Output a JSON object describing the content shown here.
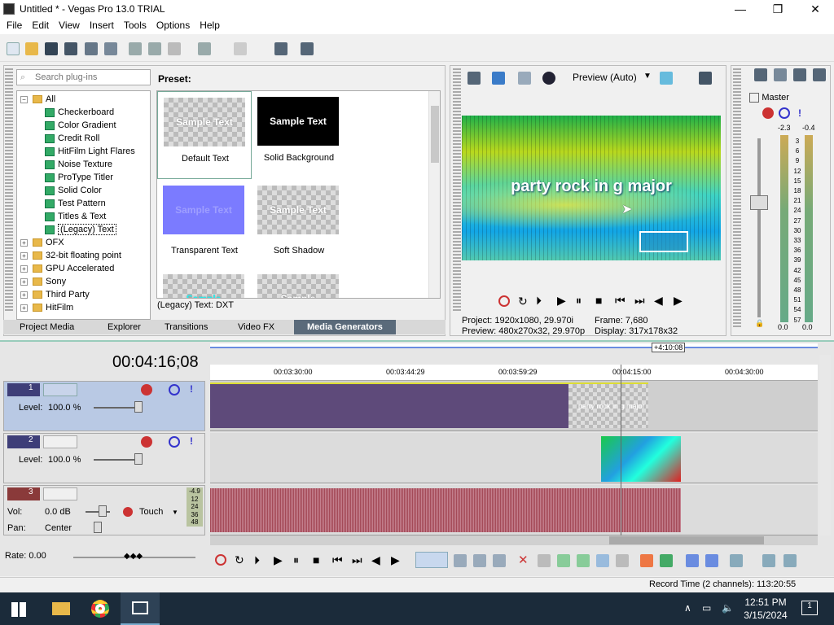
{
  "window": {
    "title": "Untitled * - Vegas Pro 13.0 TRIAL",
    "min": "—",
    "max": "❐",
    "close": "✕"
  },
  "menu": [
    "File",
    "Edit",
    "View",
    "Insert",
    "Tools",
    "Options",
    "Help"
  ],
  "explorer": {
    "search_placeholder": "Search plug-ins",
    "preset_label": "Preset:",
    "tree": [
      {
        "label": "All",
        "type": "folder",
        "level": 0,
        "exp": "−"
      },
      {
        "label": "Checkerboard",
        "type": "plugin",
        "level": 1
      },
      {
        "label": "Color Gradient",
        "type": "plugin",
        "level": 1
      },
      {
        "label": "Credit Roll",
        "type": "plugin",
        "level": 1
      },
      {
        "label": "HitFilm Light Flares",
        "type": "plugin",
        "level": 1
      },
      {
        "label": "Noise Texture",
        "type": "plugin",
        "level": 1
      },
      {
        "label": "ProType Titler",
        "type": "plugin",
        "level": 1
      },
      {
        "label": "Solid Color",
        "type": "plugin",
        "level": 1
      },
      {
        "label": "Test Pattern",
        "type": "plugin",
        "level": 1
      },
      {
        "label": "Titles & Text",
        "type": "plugin",
        "level": 1
      },
      {
        "label": "(Legacy) Text",
        "type": "plugin",
        "level": 1,
        "selected": true
      },
      {
        "label": "OFX",
        "type": "folder",
        "level": 0,
        "exp": "+"
      },
      {
        "label": "32-bit floating point",
        "type": "folder",
        "level": 0,
        "exp": "+"
      },
      {
        "label": "GPU Accelerated",
        "type": "folder",
        "level": 0,
        "exp": "+"
      },
      {
        "label": "Sony",
        "type": "folder",
        "level": 0,
        "exp": "+"
      },
      {
        "label": "Third Party",
        "type": "folder",
        "level": 0,
        "exp": "+"
      },
      {
        "label": "HitFilm",
        "type": "folder",
        "level": 0,
        "exp": "+"
      }
    ],
    "presets": [
      {
        "name": "Default Text",
        "thumb": "Sample Text",
        "style": "checker",
        "selected": true
      },
      {
        "name": "Solid Background",
        "thumb": "Sample Text",
        "style": "black"
      },
      {
        "name": "Transparent Text",
        "thumb": "Sample Text",
        "style": "blue"
      },
      {
        "name": "Soft Shadow",
        "thumb": "Sample Text",
        "style": "checker"
      },
      {
        "name": "",
        "thumb": "Sample",
        "style": "checker-cyan"
      },
      {
        "name": "",
        "thumb": "Sample",
        "style": "checker"
      }
    ],
    "status": "(Legacy) Text: DXT",
    "tabs": [
      "Project Media",
      "Explorer",
      "Transitions",
      "Video FX",
      "Media Generators"
    ],
    "active_tab": "Media Generators"
  },
  "preview": {
    "mode": "Preview (Auto)",
    "overlay_text": "party rock in g major",
    "project_label": "Project:",
    "project_value": "1920x1080, 29.970i",
    "frame_label": "Frame:",
    "frame_value": "7,680",
    "preview_label": "Preview:",
    "preview_value": "480x270x32, 29.970p",
    "display_label": "Display:",
    "display_value": "317x178x32"
  },
  "mixer": {
    "title": "Master",
    "left_peak": "-2.3",
    "right_peak": "-0.4",
    "scale": [
      "3",
      "6",
      "9",
      "12",
      "15",
      "18",
      "21",
      "24",
      "27",
      "30",
      "33",
      "36",
      "39",
      "42",
      "45",
      "48",
      "51",
      "54",
      "57"
    ],
    "left_level": "0.0",
    "right_level": "0.0"
  },
  "timeline": {
    "timecode": "00:04:16;08",
    "offset": "+4:10:08",
    "ruler": [
      "00:03:30:00",
      "00:03:44:29",
      "00:03:59:29",
      "00:04:15:00",
      "00:04:30:00"
    ],
    "tracks": [
      {
        "num": "1",
        "level_label": "Level:",
        "level": "100.0 %",
        "clip_text": "party rock in g major"
      },
      {
        "num": "2",
        "level_label": "Level:",
        "level": "100.0 %"
      },
      {
        "num": "3",
        "vol_label": "Vol:",
        "vol": "0.0 dB",
        "pan_label": "Pan:",
        "pan": "Center",
        "mode": "Touch",
        "meter": [
          "-4.9",
          "12",
          "24",
          "36",
          "48"
        ]
      }
    ],
    "rate_label": "Rate: 0.00"
  },
  "status": {
    "record_time": "Record Time (2 channels): 113:20:55"
  },
  "taskbar": {
    "time": "12:51 PM",
    "date": "3/15/2024",
    "notif": "1"
  }
}
